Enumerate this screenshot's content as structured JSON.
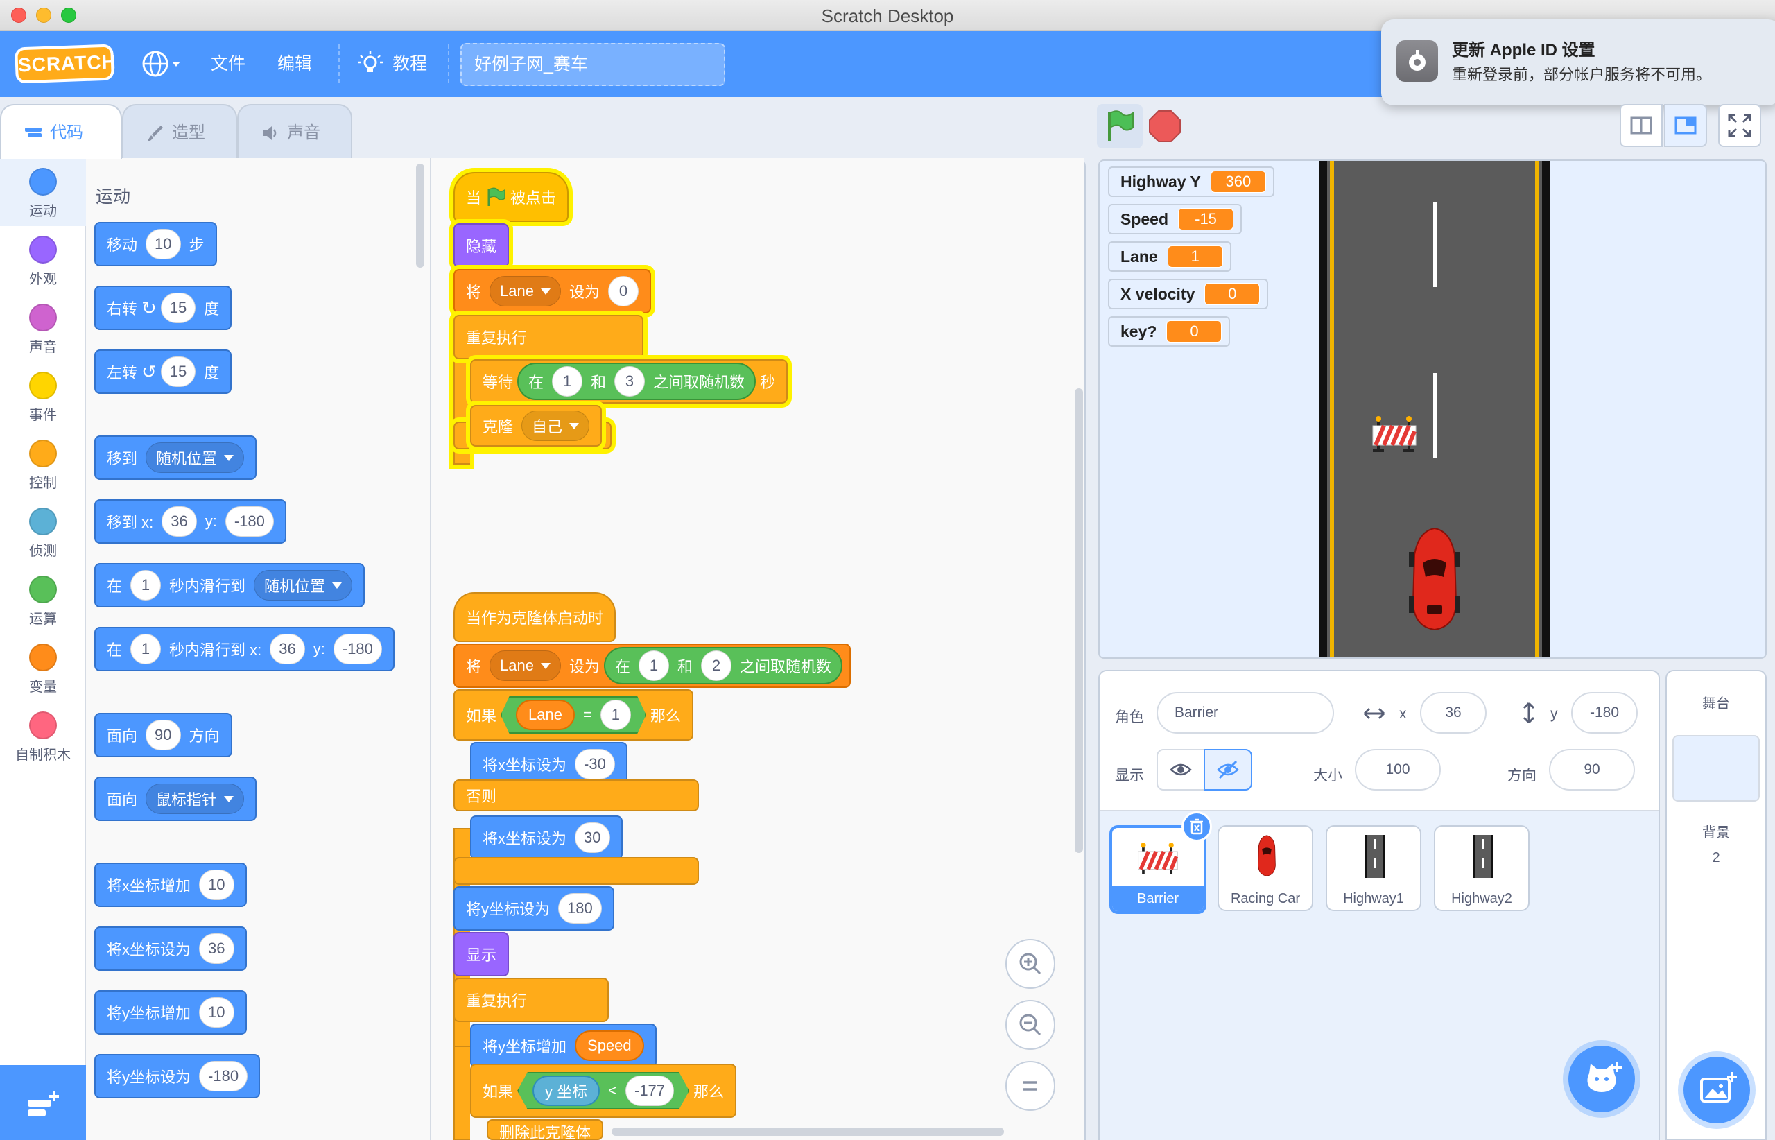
{
  "window": {
    "title": "Scratch Desktop"
  },
  "menubar": {
    "logo": "SCRATCH",
    "file": "文件",
    "edit": "编辑",
    "tutorials": "教程",
    "project_title": "好例子网_赛车"
  },
  "notification": {
    "title": "更新 Apple ID 设置",
    "body": "重新登录前，部分帐户服务将不可用。"
  },
  "tabs": {
    "code": "代码",
    "costumes": "造型",
    "sounds": "声音"
  },
  "categories": [
    {
      "label": "运动",
      "color": "#4c97ff"
    },
    {
      "label": "外观",
      "color": "#9966ff"
    },
    {
      "label": "声音",
      "color": "#cf63cf"
    },
    {
      "label": "事件",
      "color": "#ffd500"
    },
    {
      "label": "控制",
      "color": "#ffab19"
    },
    {
      "label": "侦测",
      "color": "#5cb1d6"
    },
    {
      "label": "运算",
      "color": "#59c059"
    },
    {
      "label": "变量",
      "color": "#ff8c1a"
    },
    {
      "label": "自制积木",
      "color": "#ff6680"
    }
  ],
  "palette": {
    "heading": "运动",
    "move": {
      "a": "移动",
      "n": "10",
      "b": "步"
    },
    "turn_right": {
      "a": "右转",
      "n": "15",
      "b": "度"
    },
    "turn_left": {
      "a": "左转",
      "n": "15",
      "b": "度"
    },
    "goto": {
      "a": "移到",
      "dd": "随机位置"
    },
    "goto_xy": {
      "a": "移到 x:",
      "x": "36",
      "y_label": "y:",
      "y": "-180"
    },
    "glide": {
      "a": "在",
      "n": "1",
      "b": "秒内滑行到",
      "dd": "随机位置"
    },
    "glide_xy": {
      "a": "在",
      "n": "1",
      "b": "秒内滑行到 x:",
      "x": "36",
      "y_label": "y:",
      "y": "-180"
    },
    "point": {
      "a": "面向",
      "n": "90",
      "b": "方向"
    },
    "point_towards": {
      "a": "面向",
      "dd": "鼠标指针"
    },
    "change_x": {
      "a": "将x坐标增加",
      "n": "10"
    },
    "set_x": {
      "a": "将x坐标设为",
      "n": "36"
    },
    "change_y": {
      "a": "将y坐标增加",
      "n": "10"
    },
    "set_y": {
      "a": "将y坐标设为",
      "n": "-180"
    }
  },
  "script1": {
    "hat": {
      "a": "当",
      "b": "被点击"
    },
    "hide": "隐藏",
    "set_lane": {
      "a": "将",
      "var": "Lane",
      "b": "设为",
      "v": "0"
    },
    "forever": "重复执行",
    "wait": {
      "a": "等待",
      "b": "在",
      "n1": "1",
      "c": "和",
      "n2": "3",
      "d": "之间取随机数",
      "e": "秒"
    },
    "clone": {
      "a": "克隆",
      "dd": "自己"
    }
  },
  "script2": {
    "hat": "当作为克隆体启动时",
    "set_lane": {
      "a": "将",
      "var": "Lane",
      "b": "设为",
      "c": "在",
      "n1": "1",
      "d": "和",
      "n2": "2",
      "e": "之间取随机数"
    },
    "if": {
      "a": "如果",
      "rep": "Lane",
      "eq": "=",
      "v": "1",
      "b": "那么"
    },
    "set_x1": {
      "a": "将x坐标设为",
      "v": "-30"
    },
    "else": "否则",
    "set_x2": {
      "a": "将x坐标设为",
      "v": "30"
    },
    "set_y": {
      "a": "将y坐标设为",
      "v": "180"
    },
    "show": "显示",
    "forever": "重复执行",
    "change_y": {
      "a": "将y坐标增加",
      "rep": "Speed"
    },
    "if2": {
      "a": "如果",
      "rep": "y 坐标",
      "lt": "<",
      "v": "-177",
      "b": "那么"
    },
    "delete": "删除此克隆体"
  },
  "monitors": [
    {
      "name": "Highway Y",
      "value": "360"
    },
    {
      "name": "Speed",
      "value": "-15"
    },
    {
      "name": "Lane",
      "value": "1"
    },
    {
      "name": "X velocity",
      "value": "0"
    },
    {
      "name": "key?",
      "value": "0"
    }
  ],
  "sprite_info": {
    "sprite_label": "角色",
    "sprite_name": "Barrier",
    "x_label": "x",
    "x": "36",
    "y_label": "y",
    "y": "-180",
    "show_label": "显示",
    "size_label": "大小",
    "size": "100",
    "direction_label": "方向",
    "direction": "90"
  },
  "sprites": [
    {
      "name": "Barrier",
      "selected": true
    },
    {
      "name": "Racing Car",
      "selected": false
    },
    {
      "name": "Highway1",
      "selected": false
    },
    {
      "name": "Highway2",
      "selected": false
    }
  ],
  "stage_pane": {
    "title": "舞台",
    "backdrops_label": "背景",
    "backdrops_count": "2"
  }
}
